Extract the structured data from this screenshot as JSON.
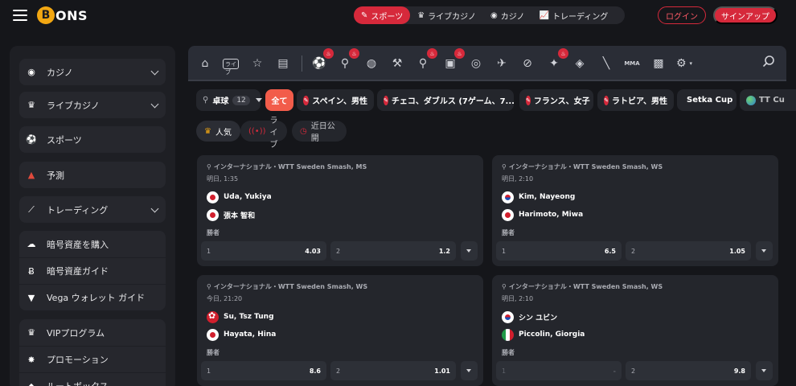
{
  "header": {
    "logo_text": "ONS",
    "logo_initial": "B",
    "nav": [
      {
        "label": "スポーツ",
        "icon": "sports-icon",
        "active": true
      },
      {
        "label": "ライブカジノ",
        "icon": "live-casino-icon",
        "active": false
      },
      {
        "label": "カジノ",
        "icon": "casino-icon",
        "active": false
      },
      {
        "label": "トレーディング",
        "icon": "trading-icon",
        "active": false
      }
    ],
    "login_label": "ログイン",
    "signup_label": "サインアップ"
  },
  "sidebar": {
    "items": [
      {
        "label": "カジノ",
        "icon": "casino-icon",
        "expandable": true
      },
      {
        "label": "ライブカジノ",
        "icon": "live-casino-icon",
        "expandable": true
      },
      {
        "label": "スポーツ",
        "icon": "soccer-ball-icon",
        "expandable": false
      },
      {
        "label": "予測",
        "icon": "prediction-icon",
        "expandable": false
      },
      {
        "label": "トレーディング",
        "icon": "trading-chart-icon",
        "expandable": true
      },
      {
        "label": "暗号資産を購入",
        "icon": "piggy-bank-icon",
        "expandable": false
      },
      {
        "label": "暗号資産ガイド",
        "icon": "bitcoin-icon",
        "expandable": false
      },
      {
        "label": "Vega ウォレット ガイド",
        "icon": "vega-icon",
        "expandable": false
      },
      {
        "label": "VIPプログラム",
        "icon": "crown-icon",
        "expandable": false
      },
      {
        "label": "プロモーション",
        "icon": "star-icon",
        "expandable": false
      },
      {
        "label": "ルートボックス",
        "icon": "loot-box-icon",
        "expandable": false
      }
    ]
  },
  "sports_bar": {
    "icons": [
      "home-icon",
      "live-icon",
      "favorites-star-icon",
      "betslip-icon",
      "soccer-icon",
      "tennis-icon",
      "basketball-icon",
      "hockey-icon",
      "table-tennis-icon",
      "esports-icon",
      "volleyball-icon",
      "darts-icon",
      "badminton-icon",
      "cricket-icon",
      "futsal-icon",
      "counter-strike-icon",
      "mma-icon",
      "cyber-icon",
      "more-sports-icon"
    ],
    "live_label": "ライブ",
    "mma_label": "MMA"
  },
  "filters": {
    "sport_label": "卓球",
    "sport_count": "12",
    "chips": [
      {
        "label": "全て",
        "type": "all"
      },
      {
        "label": "スペイン、男性",
        "type": "flag"
      },
      {
        "label": "チェコ、ダブルス (7ゲーム、7...",
        "type": "flag"
      },
      {
        "label": "フランス、女子",
        "type": "flag"
      },
      {
        "label": "ラトビア、男性",
        "type": "flag"
      },
      {
        "label": "Setka Cup",
        "type": "globe"
      },
      {
        "label": "TT Cu",
        "type": "globe"
      }
    ],
    "tabs": [
      {
        "label": "人気",
        "icon": "crown-icon",
        "active": true
      },
      {
        "label": "ライブ",
        "icon": "live-broadcast-icon",
        "active": false
      },
      {
        "label": "近日公開",
        "icon": "upcoming-icon",
        "active": false
      }
    ]
  },
  "matches": [
    {
      "league": "インターナショナル・WTT Sweden Smash, MS",
      "time": "明日, 1:35",
      "team1": {
        "name": "Uda, Yukiya",
        "flag": "jp"
      },
      "team2": {
        "name": "張本 智和",
        "flag": "jp"
      },
      "market": "勝者",
      "odds": [
        {
          "label": "1",
          "value": "4.03"
        },
        {
          "label": "2",
          "value": "1.2"
        }
      ]
    },
    {
      "league": "インターナショナル・WTT Sweden Smash, WS",
      "time": "明日, 2:10",
      "team1": {
        "name": "Kim, Nayeong",
        "flag": "kr"
      },
      "team2": {
        "name": "Harimoto, Miwa",
        "flag": "jp"
      },
      "market": "勝者",
      "odds": [
        {
          "label": "1",
          "value": "6.5"
        },
        {
          "label": "2",
          "value": "1.05"
        }
      ]
    },
    {
      "league": "インターナショナル・WTT Sweden Smash, WS",
      "time": "今日, 21:20",
      "team1": {
        "name": "Su, Tsz Tung",
        "flag": "hk"
      },
      "team2": {
        "name": "Hayata, Hina",
        "flag": "jp"
      },
      "market": "勝者",
      "odds": [
        {
          "label": "1",
          "value": "8.6"
        },
        {
          "label": "2",
          "value": "1.01"
        }
      ]
    },
    {
      "league": "インターナショナル・WTT Sweden Smash, WS",
      "time": "明日, 2:10",
      "team1": {
        "name": "シン ユビン",
        "flag": "kr"
      },
      "team2": {
        "name": "Piccolin, Giorgia",
        "flag": "it"
      },
      "market": "勝者",
      "odds": [
        {
          "label": "1",
          "value": "-"
        },
        {
          "label": "2",
          "value": "9.8"
        }
      ]
    }
  ],
  "colors": {
    "accent": "#d6293b",
    "chip_all": "#f25c4a",
    "background": "#15161a",
    "panel": "#24262c"
  }
}
